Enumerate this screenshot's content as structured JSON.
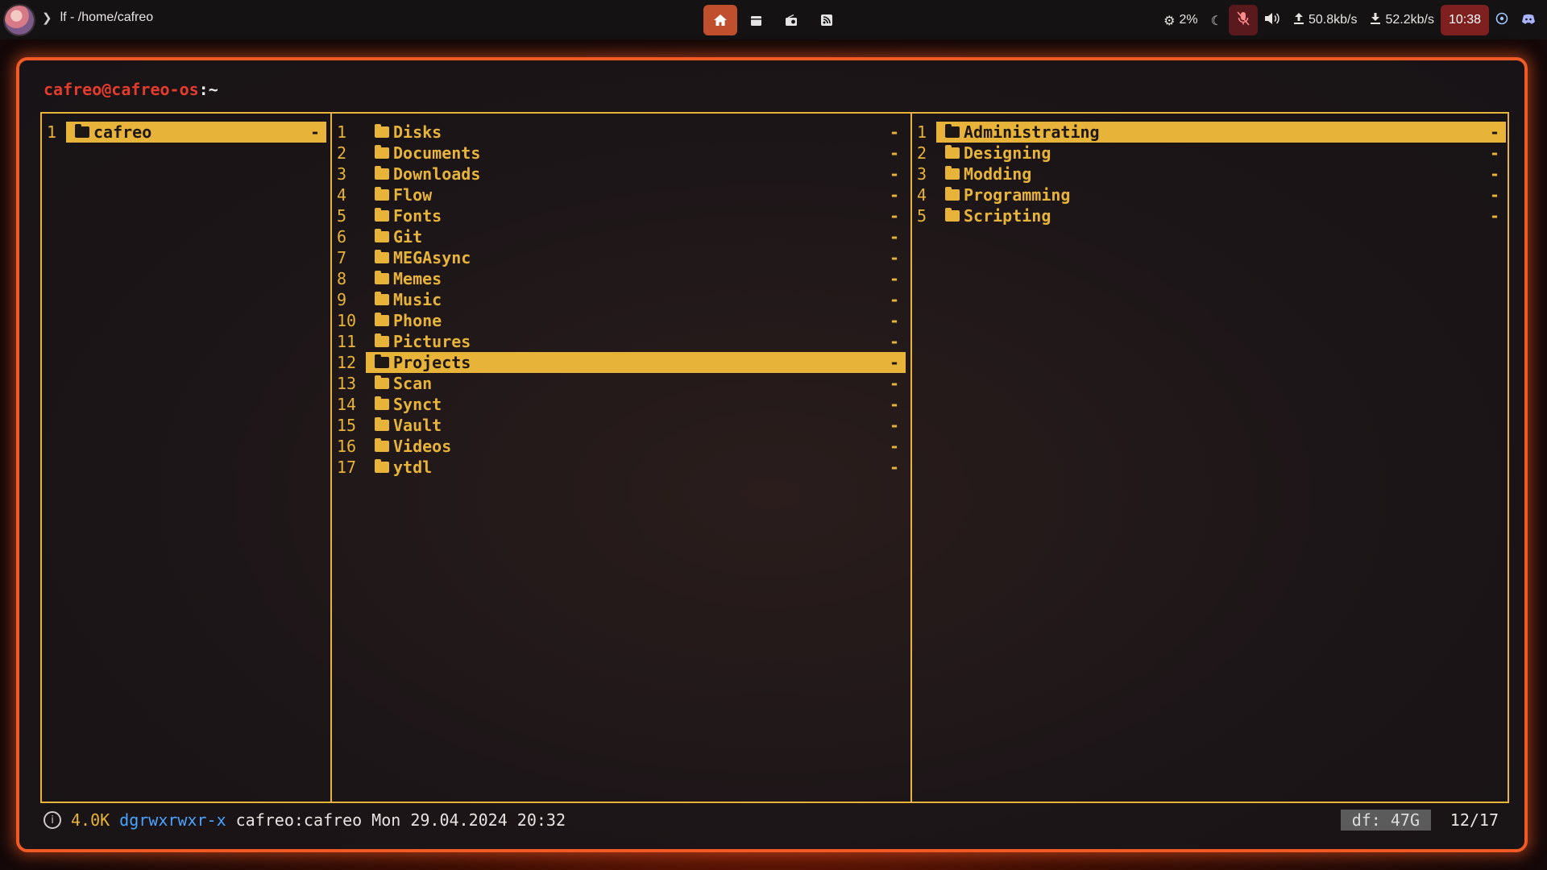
{
  "topbar": {
    "window_title": "lf - /home/cafreo",
    "center_icons": [
      "home-icon",
      "calendar-icon",
      "radio-icon",
      "rss-icon"
    ],
    "cpu": "2%",
    "net_up": "50.8kb/s",
    "net_down": "52.2kb/s",
    "clock": "10:38"
  },
  "terminal": {
    "prompt_user": "cafreo@cafreo-os",
    "prompt_path": ":~"
  },
  "panes": {
    "parent": [
      {
        "num": "1",
        "name": "cafreo",
        "size": "-",
        "selected": true
      }
    ],
    "current": [
      {
        "num": "1",
        "name": "Disks",
        "size": "-"
      },
      {
        "num": "2",
        "name": "Documents",
        "size": "-"
      },
      {
        "num": "3",
        "name": "Downloads",
        "size": "-"
      },
      {
        "num": "4",
        "name": "Flow",
        "size": "-"
      },
      {
        "num": "5",
        "name": "Fonts",
        "size": "-"
      },
      {
        "num": "6",
        "name": "Git",
        "size": "-"
      },
      {
        "num": "7",
        "name": "MEGAsync",
        "size": "-"
      },
      {
        "num": "8",
        "name": "Memes",
        "size": "-"
      },
      {
        "num": "9",
        "name": "Music",
        "size": "-"
      },
      {
        "num": "10",
        "name": "Phone",
        "size": "-"
      },
      {
        "num": "11",
        "name": "Pictures",
        "size": "-"
      },
      {
        "num": "12",
        "name": "Projects",
        "size": "-",
        "selected": true
      },
      {
        "num": "13",
        "name": "Scan",
        "size": "-"
      },
      {
        "num": "14",
        "name": "Synct",
        "size": "-"
      },
      {
        "num": "15",
        "name": "Vault",
        "size": "-"
      },
      {
        "num": "16",
        "name": "Videos",
        "size": "-"
      },
      {
        "num": "17",
        "name": "ytdl",
        "size": "-"
      }
    ],
    "preview": [
      {
        "num": "1",
        "name": "Administrating",
        "size": "-",
        "selected": true
      },
      {
        "num": "2",
        "name": "Designing",
        "size": "-"
      },
      {
        "num": "3",
        "name": "Modding",
        "size": "-"
      },
      {
        "num": "4",
        "name": "Programming",
        "size": "-"
      },
      {
        "num": "5",
        "name": "Scripting",
        "size": "-"
      }
    ]
  },
  "statusline": {
    "size": "4.0K",
    "permissions": "dgrwxrwxr-x",
    "owner": "cafreo:cafreo",
    "date": "Mon 29.04.2024 20:32",
    "df": "df: 47G",
    "position": "12/17"
  }
}
